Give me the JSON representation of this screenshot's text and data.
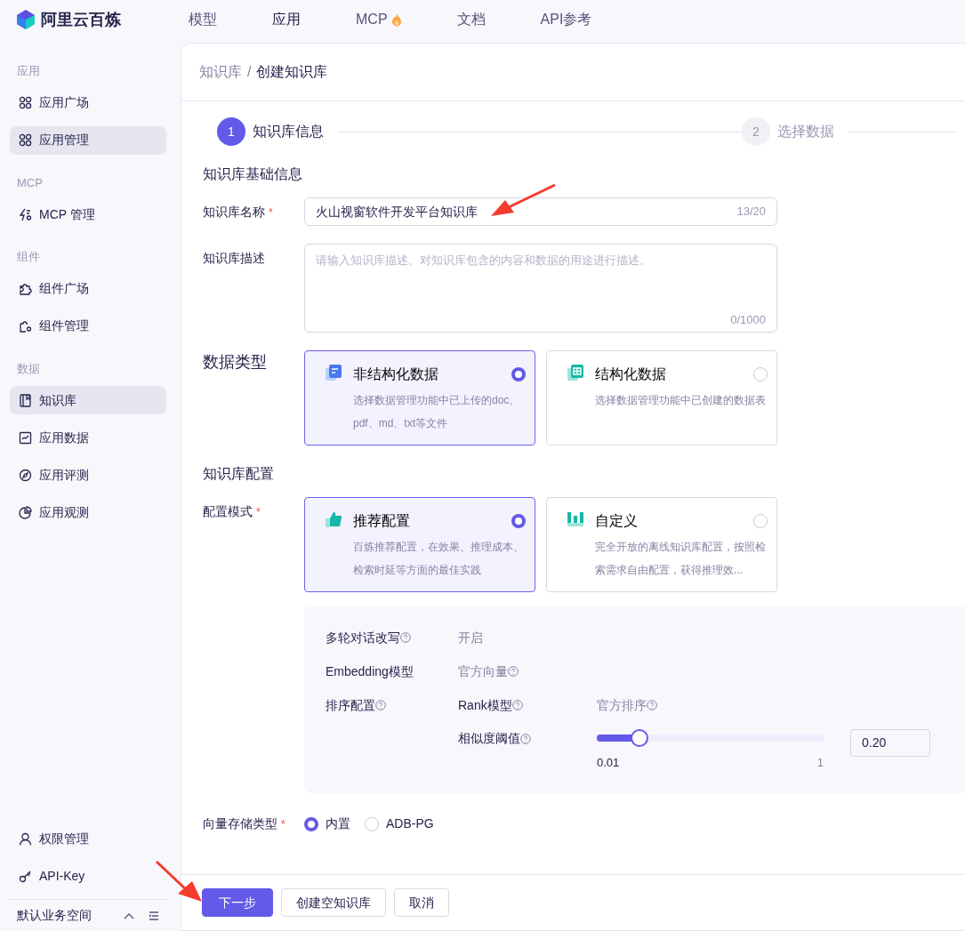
{
  "logo": {
    "text": "阿里云百炼"
  },
  "top_nav": [
    {
      "label": "模型",
      "selected": false,
      "hot": false
    },
    {
      "label": "应用",
      "selected": true,
      "hot": false
    },
    {
      "label": "MCP",
      "selected": false,
      "hot": true
    },
    {
      "label": "文档",
      "selected": false,
      "hot": false
    },
    {
      "label": "API参考",
      "selected": false,
      "hot": false
    }
  ],
  "sidebar": {
    "sections": [
      {
        "title": "应用",
        "items": [
          {
            "label": "应用广场",
            "selected": false
          },
          {
            "label": "应用管理",
            "selected": true
          }
        ]
      },
      {
        "title": "MCP",
        "items": [
          {
            "label": "MCP 管理",
            "selected": false
          }
        ]
      },
      {
        "title": "组件",
        "items": [
          {
            "label": "组件广场",
            "selected": false
          },
          {
            "label": "组件管理",
            "selected": false
          }
        ]
      },
      {
        "title": "数据",
        "items": [
          {
            "label": "知识库",
            "selected": true
          },
          {
            "label": "应用数据",
            "selected": false
          },
          {
            "label": "应用评测",
            "selected": false
          },
          {
            "label": "应用观测",
            "selected": false
          }
        ]
      }
    ],
    "bottom_items": [
      {
        "label": "权限管理"
      },
      {
        "label": "API-Key"
      }
    ],
    "workspace": "默认业务空间"
  },
  "breadcrumb": {
    "items": [
      "知识库",
      "创建知识库"
    ],
    "separator": "/"
  },
  "steps": [
    {
      "number": "1",
      "label": "知识库信息",
      "selected": true
    },
    {
      "number": "2",
      "label": "选择数据",
      "selected": false
    }
  ],
  "basic_section": {
    "title": "知识库基础信息",
    "name_field": {
      "label": "知识库名称",
      "required_mark": "*",
      "value": "火山视窗软件开发平台知识库",
      "count": "13/20"
    },
    "description_field": {
      "label": "知识库描述",
      "placeholder": "请输入知识库描述。对知识库包含的内容和数据的用途进行描述。",
      "count": "0/1000"
    }
  },
  "data_type": {
    "label": "数据类型",
    "options": [
      {
        "title": "非结构化数据",
        "description": "选择数据管理功能中已上传的doc、pdf、md、txt等文件",
        "selected": true
      },
      {
        "title": "结构化数据",
        "description": "选择数据管理功能中已创建的数据表",
        "selected": false
      }
    ]
  },
  "config_section": {
    "title": "知识库配置",
    "mode_label": "配置模式",
    "required_mark": "*",
    "options": [
      {
        "title": "推荐配置",
        "description": "百炼推荐配置，在效果、推理成本、检索时延等方面的最佳实践",
        "selected": true
      },
      {
        "title": "自定义",
        "description": "完全开放的离线知识库配置，按照检索需求自由配置，获得推理效...",
        "selected": false
      }
    ]
  },
  "settings": {
    "multi_turn": {
      "label": "多轮对话改写",
      "value": "开启"
    },
    "embedding": {
      "label": "Embedding模型",
      "value": "官方向量"
    },
    "ranking": {
      "label": "排序配置",
      "rank_label": "Rank模型",
      "rank_value": "官方排序",
      "threshold": {
        "label": "相似度阈值",
        "level": 0.19,
        "min": "0.01",
        "max": "1",
        "value": "0.20"
      }
    }
  },
  "vector_storage": {
    "label": "向量存储类型",
    "required_mark": "*",
    "options": [
      {
        "label": "内置",
        "selected": true
      },
      {
        "label": "ADB-PG",
        "selected": false
      }
    ]
  },
  "buttons": [
    {
      "label": "下一步",
      "kind": "primary"
    },
    {
      "label": "创建空知识库",
      "kind": "secondary"
    },
    {
      "label": "取消",
      "kind": "secondary"
    }
  ],
  "annotations": [
    {
      "kind": "arrow"
    },
    {
      "kind": "arrow"
    }
  ]
}
